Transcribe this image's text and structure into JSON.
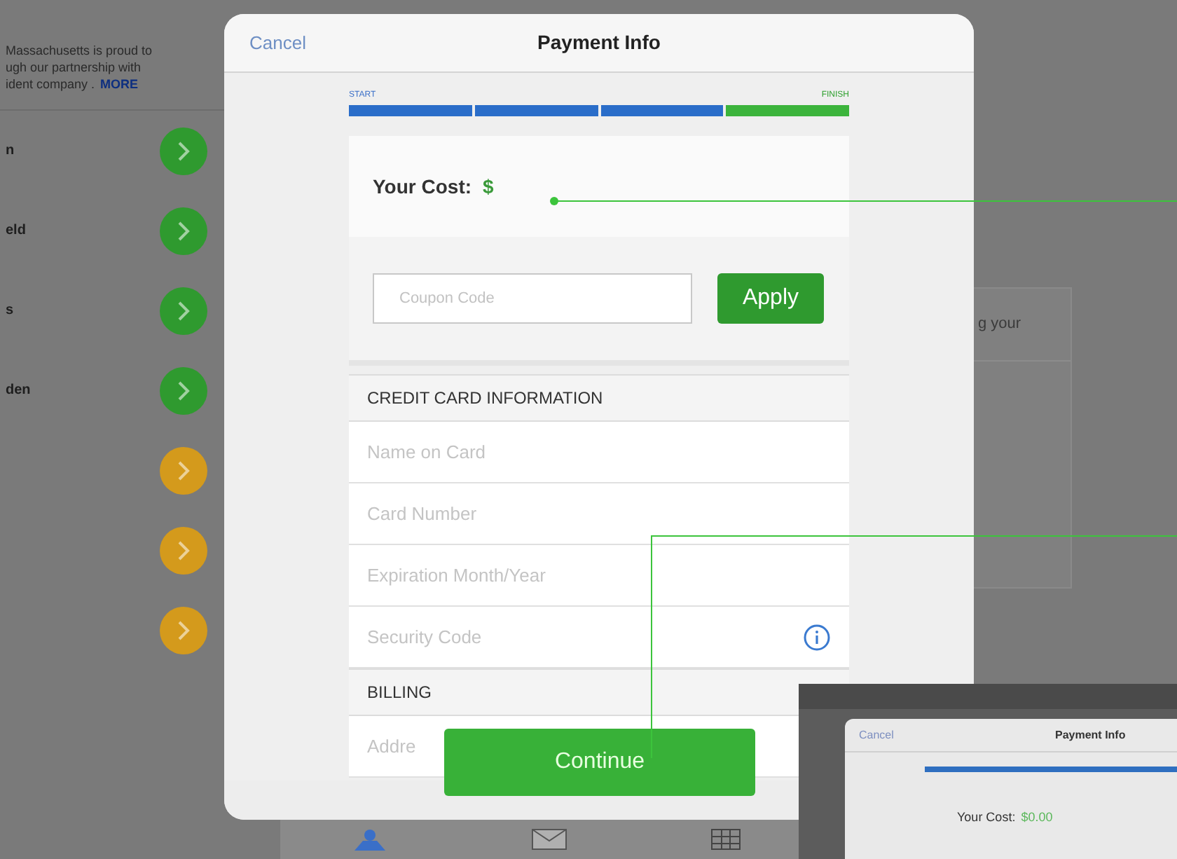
{
  "background": {
    "intro": [
      "Massachusetts is proud to",
      "ugh our partnership with",
      "ident company ."
    ],
    "intro_link": "MORE",
    "items": [
      {
        "label": "n",
        "color": "#2f9a2f"
      },
      {
        "label": "eld",
        "color": "#2f9a2f"
      },
      {
        "label": "s",
        "color": "#2f9a2f"
      },
      {
        "label": "den",
        "color": "#2f9a2f"
      },
      {
        "color": "#d49a1c"
      },
      {
        "color": "#d49a1c"
      },
      {
        "color": "#d49a1c"
      }
    ],
    "side_panel_text": "g your"
  },
  "modal": {
    "cancel": "Cancel",
    "title": "Payment Info",
    "progress": {
      "start": "START",
      "finish": "FINISH",
      "steps": [
        {
          "completed": true
        },
        {
          "completed": true
        },
        {
          "completed": true
        },
        {
          "completed": false
        }
      ]
    },
    "cost_label": "Your Cost:",
    "cost_value": "$",
    "coupon": {
      "placeholder": "Coupon Code"
    },
    "apply": "Apply",
    "sections": [
      {
        "heading": "CREDIT CARD INFORMATION",
        "fields": [
          {
            "placeholder": "Name on Card",
            "info": false
          },
          {
            "placeholder": "Card Number",
            "info": false
          },
          {
            "placeholder": "Expiration Month/Year",
            "info": false
          },
          {
            "placeholder": "Security Code",
            "info": true
          }
        ]
      },
      {
        "heading": "BILLING",
        "fields": [
          {
            "placeholder": "Addre",
            "info": false
          }
        ]
      }
    ],
    "continue": "Continue"
  },
  "inset": {
    "cancel": "Cancel",
    "title": "Payment Info",
    "progress": {
      "level": 1
    },
    "cost_label": "Your Cost:",
    "cost_value": "$0.00"
  }
}
